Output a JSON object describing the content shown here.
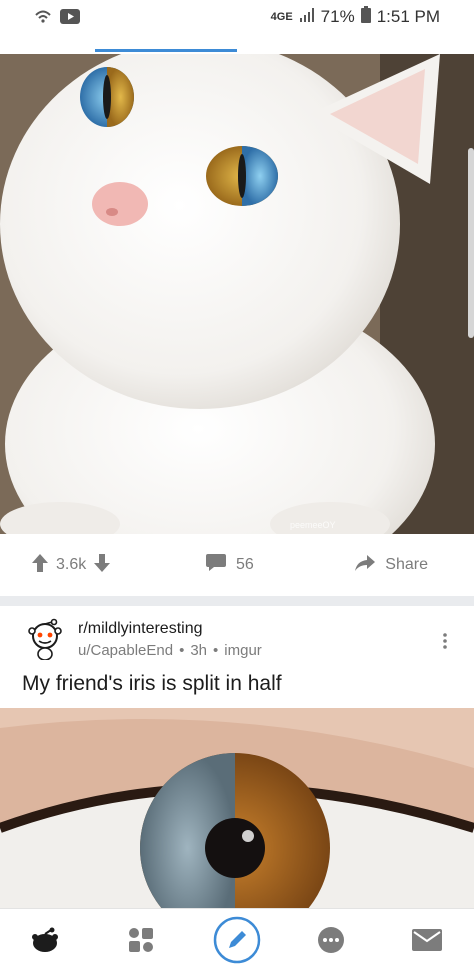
{
  "status_bar": {
    "network": "4GE",
    "battery": "71%",
    "time": "1:51 PM"
  },
  "post1": {
    "image_watermark": "peemeeOY",
    "score": "3.6k",
    "comments": "56",
    "share_label": "Share"
  },
  "post2": {
    "subreddit": "r/mildlyinteresting",
    "author": "u/CapableEnd",
    "age": "3h",
    "source": "imgur",
    "separator": "•",
    "title": "My friend's iris is split in half"
  },
  "bottom_nav": {
    "items": [
      "home-icon",
      "communities-icon",
      "create-post-icon",
      "chat-icon",
      "inbox-icon"
    ]
  },
  "colors": {
    "accent": "#3d8bd6",
    "muted": "#7c7c7c",
    "text": "#1c1c1c"
  }
}
